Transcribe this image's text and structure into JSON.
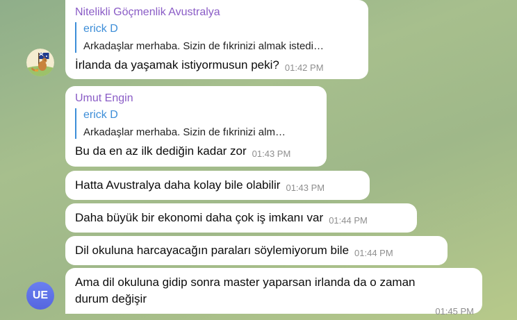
{
  "messages": [
    {
      "sender": "Nitelikli Göçmenlik Avustralya",
      "reply_name": "erick D",
      "reply_text": "Arkadaşlar merhaba. Sizin de fıkrinizi almak istedi…",
      "text": "İrlanda da yaşamak istiyormusun peki?",
      "time": "01:42 PM"
    },
    {
      "sender": "Umut Engin",
      "reply_name": "erick D",
      "reply_text": "Arkadaşlar merhaba. Sizin de fıkrinizi alm…",
      "text": "Bu da en az ilk dediğin kadar zor",
      "time": "01:43 PM"
    },
    {
      "text": "Hatta Avustralya daha kolay bile olabilir",
      "time": "01:43 PM"
    },
    {
      "text": "Daha büyük bir ekonomi daha çok iş imkanı var",
      "time": "01:44 PM"
    },
    {
      "text": "Dil okuluna harcayacağın paraları söylemiyorum bile",
      "time": "01:44 PM"
    },
    {
      "text_line1": "Ama dil okuluna gidip sonra master yaparsan irlanda da o zaman",
      "text_line2": "durum değişir",
      "time": "01:45 PM"
    }
  ],
  "avatars": {
    "group_avatar_icon": "kangaroo-flag-icon",
    "user_initials": "UE",
    "user_color": "#5b6ee8"
  }
}
